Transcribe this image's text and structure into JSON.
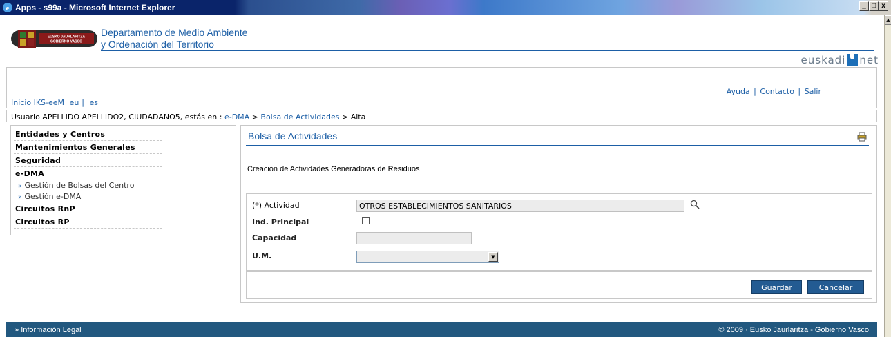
{
  "window": {
    "title": "Apps - s99a - Microsoft Internet Explorer",
    "min": "_",
    "max": "□",
    "close": "x"
  },
  "header": {
    "logo_text_1": "EUSKO JAURLARITZA",
    "logo_text_2": "GOBIERNO VASCO",
    "dept_line_1": "Departamento de Medio Ambiente",
    "dept_line_2": "y Ordenación del Territorio",
    "brand": "euskadi",
    "brand_suffix": "net"
  },
  "topnav": {
    "home": "Inicio IKS-eeM",
    "lang_eu": "eu",
    "lang_sep": "|",
    "lang_es": "es",
    "help": "Ayuda",
    "contact": "Contacto",
    "logout": "Salir",
    "sep": "|"
  },
  "breadcrumb": {
    "prefix": "Usuario APELLIDO APELLIDO2, CIUDADANO5, estás en :",
    "items": [
      "e-DMA",
      "Bolsa de Actividades",
      "Alta"
    ],
    "sep": ">"
  },
  "sidebar": {
    "items": [
      "Entidades y Centros",
      "Mantenimientos Generales",
      "Seguridad",
      "e-DMA"
    ],
    "sub_items": [
      "Gestión de Bolsas del Centro",
      "Gestión e-DMA"
    ],
    "items_after": [
      "Circuitos RnP",
      "Circuitos RP"
    ],
    "sub_arrow": "»"
  },
  "content": {
    "title": "Bolsa de Actividades",
    "subtitle": "Creación de Actividades Generadoras de Residuos",
    "form": {
      "actividad_label": "(*) Actividad",
      "actividad_value": "OTROS ESTABLECIMIENTOS SANITARIOS",
      "ind_principal_label": "Ind. Principal",
      "ind_principal_checked": false,
      "capacidad_label": "Capacidad",
      "capacidad_value": "",
      "um_label": "U.M.",
      "um_value": ""
    },
    "buttons": {
      "save": "Guardar",
      "cancel": "Cancelar"
    }
  },
  "footer": {
    "legal_arrow": "»",
    "legal": "Información Legal",
    "copyright": "© 2009 · Eusko Jaurlaritza - Gobierno Vasco"
  },
  "colors": {
    "accent": "#1d5fa6",
    "button": "#235b92",
    "footer": "#22587f"
  }
}
